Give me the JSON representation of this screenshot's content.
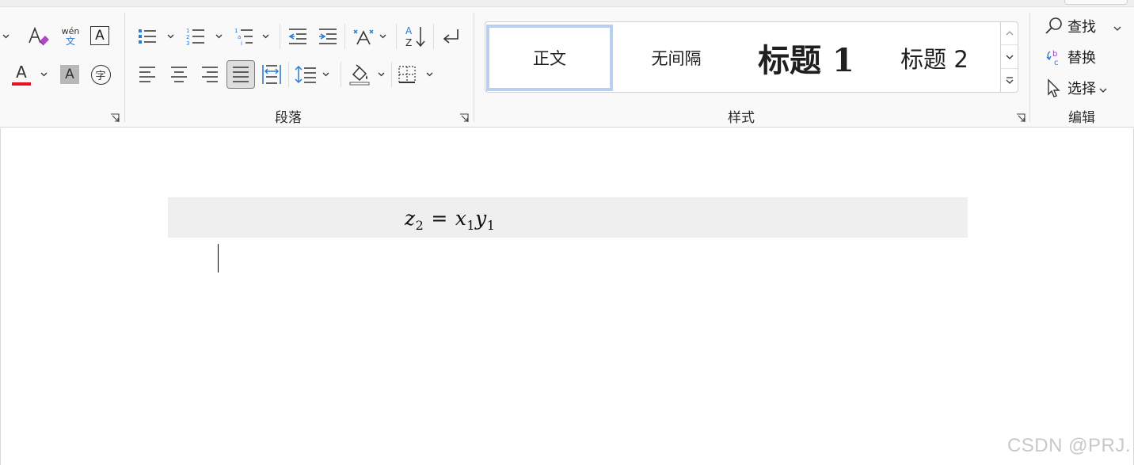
{
  "ribbon": {
    "groups": {
      "paragraph_label": "段落",
      "styles_label": "样式",
      "editing_label": "编辑"
    },
    "font_buttons": {
      "phonetic_guide_label": "wén",
      "phonetic_guide_char": "文",
      "char_border_label": "A",
      "font_color_label": "A",
      "font_color": "#e81123",
      "char_shading_label": "A",
      "enclose_char_label": "字"
    },
    "styles": {
      "items": [
        {
          "label": "正文",
          "selected": true
        },
        {
          "label": "无间隔",
          "selected": false
        },
        {
          "label": "标题 1",
          "selected": false
        },
        {
          "label": "标题 2",
          "selected": false
        }
      ]
    },
    "editing": {
      "find_label": "查找",
      "replace_label": "替换",
      "select_label": "选择"
    }
  },
  "document": {
    "equation": {
      "lhs_var": "z",
      "lhs_sub": "2",
      "op": "=",
      "rhs1_var": "x",
      "rhs1_sub": "1",
      "rhs2_var": "y",
      "rhs2_sub": "1"
    }
  },
  "watermark": "CSDN @PRJ.",
  "colors": {
    "accent_blue": "#2b7cd3",
    "selected_style_border": "#b9cfee",
    "equation_background": "#efefef"
  }
}
